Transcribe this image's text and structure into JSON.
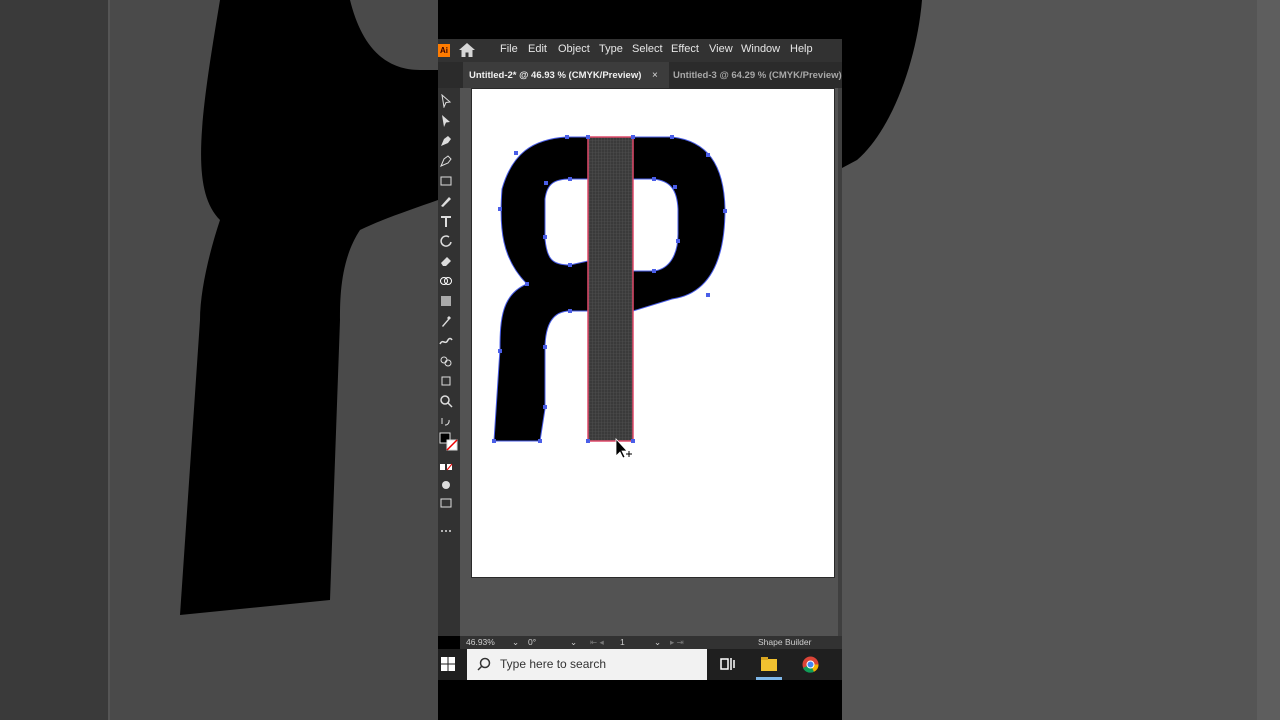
{
  "menu": {
    "logo": "Ai",
    "items": [
      "File",
      "Edit",
      "Object",
      "Type",
      "Select",
      "Effect",
      "View",
      "Window",
      "Help"
    ]
  },
  "tabs": {
    "active": "Untitled-2* @ 46.93 % (CMYK/Preview)",
    "inactive": "Untitled-3 @ 64.29 % (CMYK/Preview)",
    "close": "×"
  },
  "status": {
    "zoom": "46.93%",
    "rotation": "0°",
    "artboard": "1",
    "tool": "Shape Builder"
  },
  "taskbar": {
    "search_placeholder": "Type here to search"
  },
  "colors": {
    "accent_logo": "#ff7c00",
    "selection": "#4a5ee8",
    "highlight": "#e04a6a"
  }
}
